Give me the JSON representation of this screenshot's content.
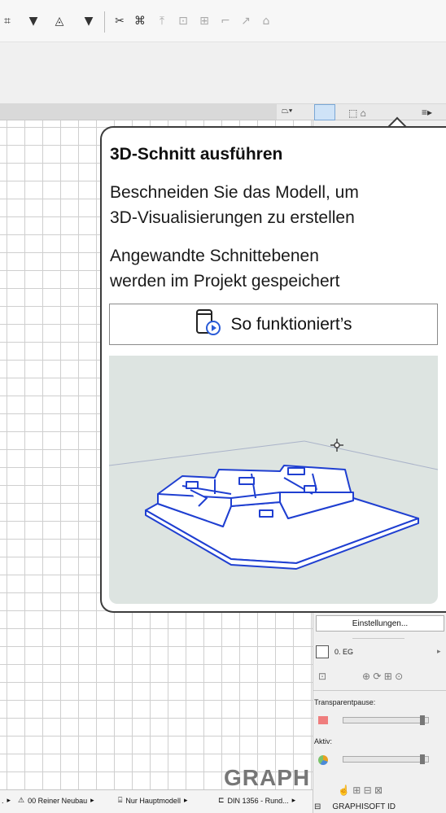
{
  "toolbar": {
    "icons": [
      "grid-snap-icon",
      "dropdown-arrow-icon",
      "triangle-snap-icon",
      "dropdown-arrow-icon",
      "scissors-icon",
      "magic-wand-icon",
      "elevate-icon",
      "fit-icon",
      "offset-icon",
      "corner-icon",
      "curve-icon",
      "house-icon"
    ]
  },
  "popover": {
    "title": "3D-Schnitt ausführen",
    "desc1_line1": "Beschneiden Sie das Modell, um",
    "desc1_line2": "3D-Visualisierungen zu erstellen",
    "desc2_line1": "Angewandte Schnittebenen",
    "desc2_line2": "werden im Projekt gespeichert",
    "howto_label": "So funktioniert’s",
    "accent": "#2a5bd7"
  },
  "right_panel": {
    "settings_button": "Einstellungen...",
    "floor_label": "0. EG",
    "transparent_label": "Transparentpause:",
    "active_label": "Aktiv:",
    "graphisoft_id": "GRAPHISOFT ID"
  },
  "statusbar": {
    "seg0": ".",
    "seg1": "00 Reiner Neubau",
    "seg2": "Nur Hauptmodell",
    "seg3": "DIN 1356 - Rund..."
  },
  "watermark": "GRAPH"
}
